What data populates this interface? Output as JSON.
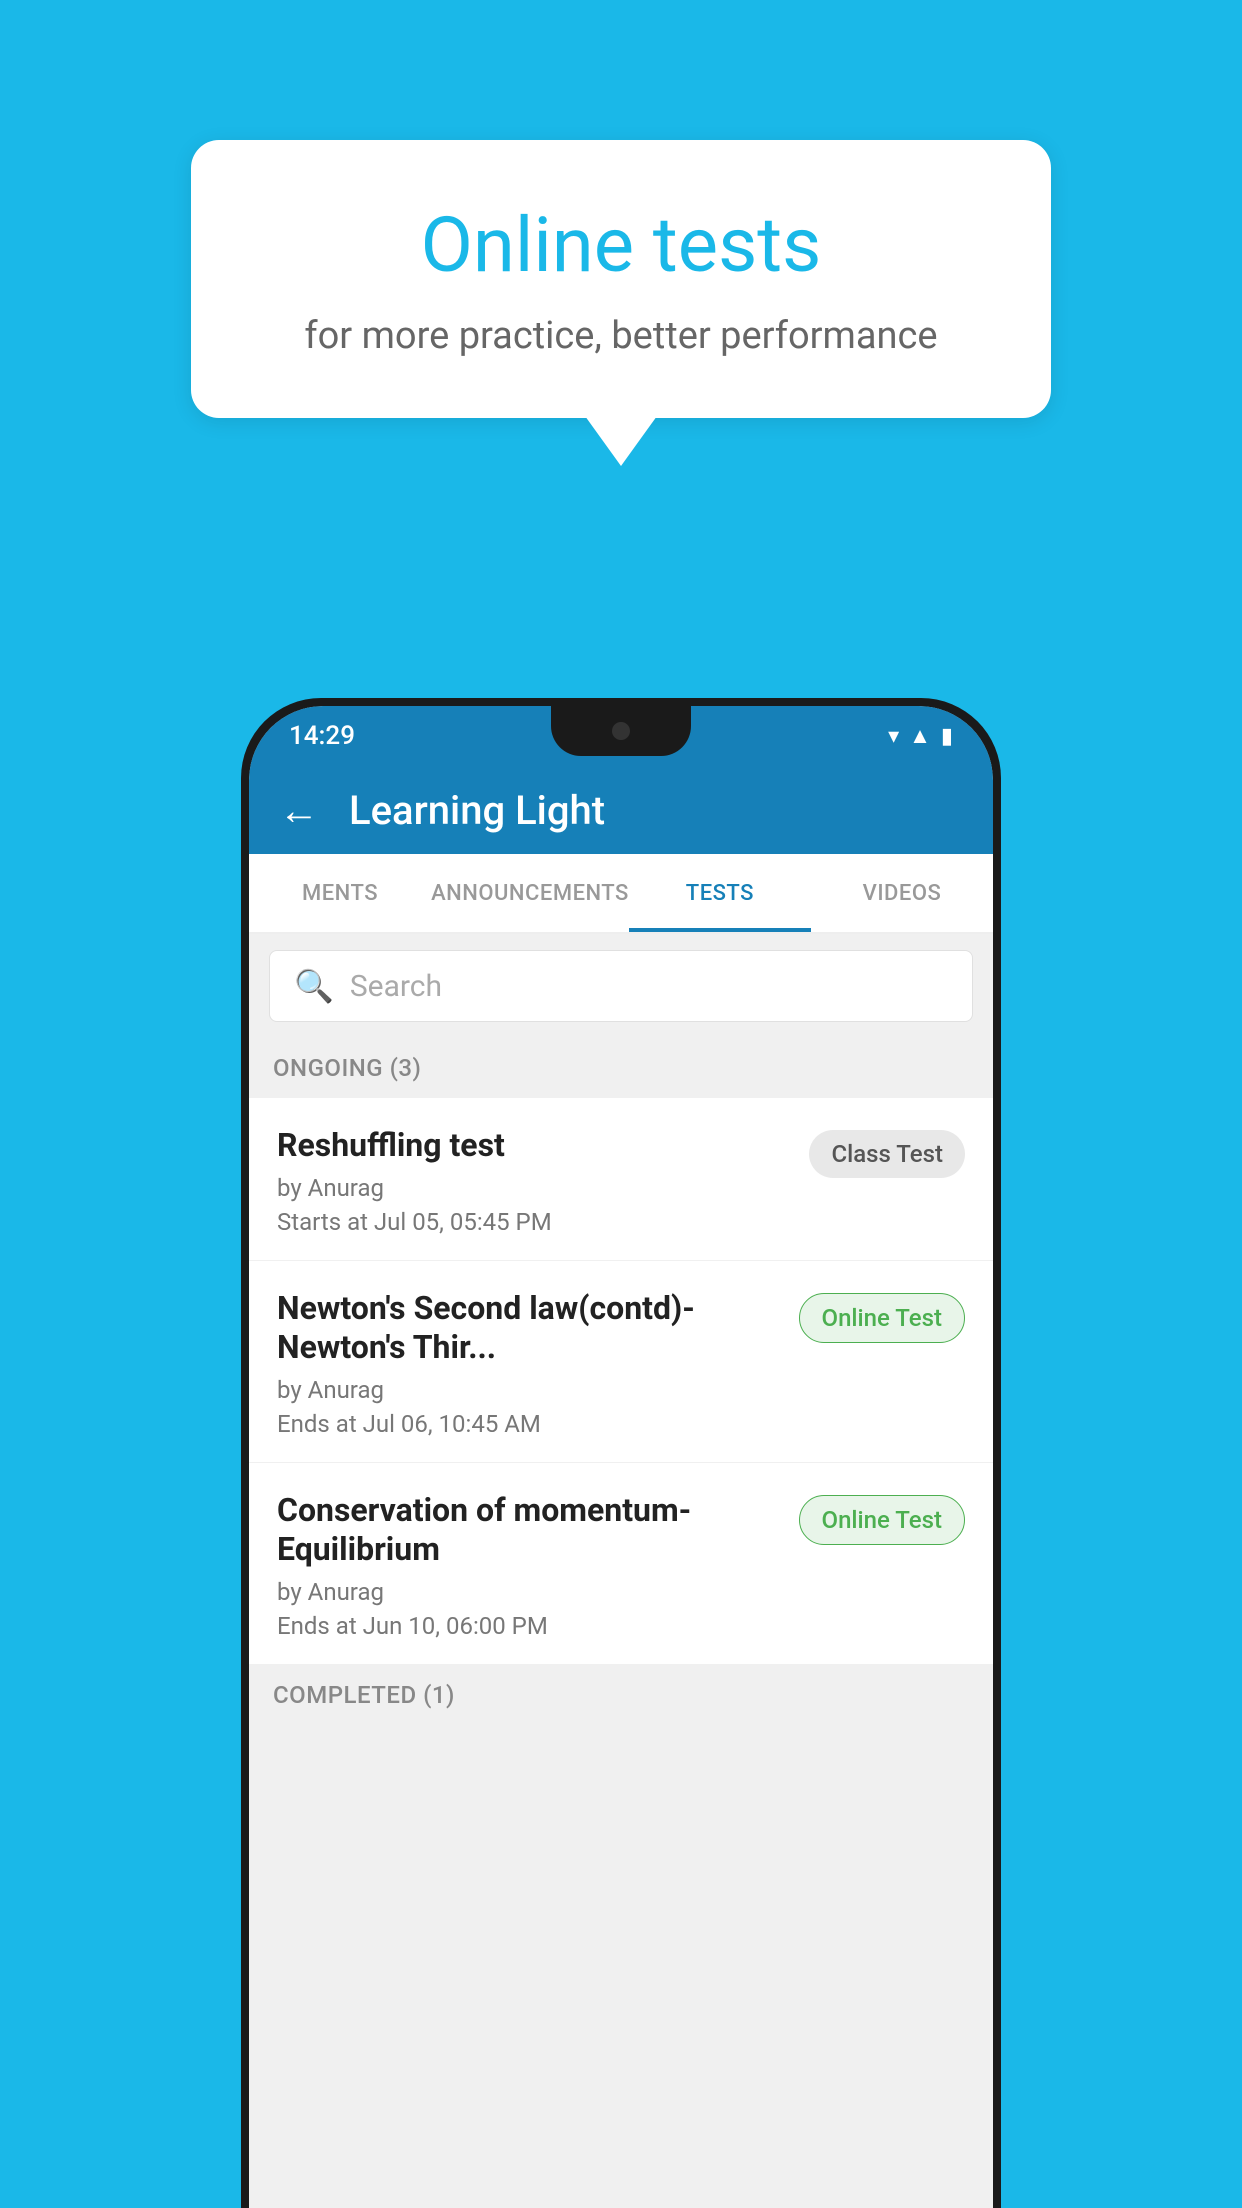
{
  "background": {
    "color": "#1ab8e8"
  },
  "speech_bubble": {
    "title": "Online tests",
    "subtitle": "for more practice, better performance"
  },
  "phone": {
    "status_bar": {
      "time": "14:29",
      "icons": "wifi signal battery"
    },
    "app_bar": {
      "back_label": "←",
      "title": "Learning Light"
    },
    "tabs": [
      {
        "label": "MENTS",
        "active": false
      },
      {
        "label": "ANNOUNCEMENTS",
        "active": false
      },
      {
        "label": "TESTS",
        "active": true
      },
      {
        "label": "VIDEOS",
        "active": false
      }
    ],
    "search": {
      "placeholder": "Search"
    },
    "sections": [
      {
        "label": "ONGOING (3)",
        "items": [
          {
            "title": "Reshuffling test",
            "by": "by Anurag",
            "time": "Starts at  Jul 05, 05:45 PM",
            "badge": "Class Test",
            "badge_type": "class"
          },
          {
            "title": "Newton's Second law(contd)-Newton's Thir...",
            "by": "by Anurag",
            "time": "Ends at  Jul 06, 10:45 AM",
            "badge": "Online Test",
            "badge_type": "online"
          },
          {
            "title": "Conservation of momentum-Equilibrium",
            "by": "by Anurag",
            "time": "Ends at  Jun 10, 06:00 PM",
            "badge": "Online Test",
            "badge_type": "online"
          }
        ]
      },
      {
        "label": "COMPLETED (1)",
        "items": []
      }
    ]
  }
}
